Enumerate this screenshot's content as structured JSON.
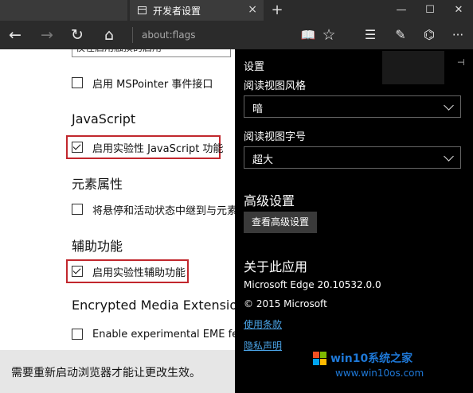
{
  "browser": {
    "tab_title": "开发者设置",
    "tab_close": "×",
    "new_tab": "+",
    "window_controls": {
      "minimize": "—",
      "maximize": "☐",
      "close": "✕"
    },
    "nav": {
      "back": "←",
      "forward": "→",
      "refresh": "↻",
      "home": "⌂"
    },
    "address": "about:flags",
    "toolbar": {
      "reading_view": "📖",
      "favorite": "☆",
      "hub": "☰",
      "note": "✎",
      "share": "⌬",
      "more": "···"
    }
  },
  "page": {
    "top_field_text": "仅在启用触摸的启用",
    "rows": [
      {
        "type": "checkbox",
        "label": "启用 MSPointer 事件接口",
        "checked": false
      },
      {
        "type": "heading",
        "label": "JavaScript"
      },
      {
        "type": "checkbox",
        "label": "启用实验性 JavaScript 功能",
        "checked": true
      },
      {
        "type": "heading",
        "label": "元素属性"
      },
      {
        "type": "checkbox",
        "label": "将悬停和活动状态中继到与元素关",
        "checked": false
      },
      {
        "type": "heading",
        "label": "辅助功能"
      },
      {
        "type": "checkbox",
        "label": "启用实验性辅助功能",
        "checked": true
      },
      {
        "type": "heading",
        "label": "Encrypted Media Extensions"
      },
      {
        "type": "checkbox",
        "label": "Enable experimental EME features",
        "checked": false
      }
    ],
    "restart_notice": "需要重新启动浏览器才能让更改生效。"
  },
  "settings": {
    "title": "设置",
    "pin": "⊣",
    "reading_style_label": "阅读视图风格",
    "reading_style_value": "暗",
    "reading_font_label": "阅读视图字号",
    "reading_font_value": "超大",
    "advanced_heading": "高级设置",
    "advanced_button": "查看高级设置",
    "about_heading": "关于此应用",
    "version": "Microsoft Edge 20.10532.0.0",
    "copyright": "© 2015 Microsoft",
    "terms_link": "使用条款",
    "privacy_link": "隐私声明"
  },
  "watermark": {
    "line1": "win10系统之家",
    "line2": "www.win10os.com"
  },
  "colors": {
    "highlight": "#c1272d",
    "link": "#4aa3e6",
    "panel_bg": "#000000",
    "chrome_bg": "#2b2b2b"
  }
}
